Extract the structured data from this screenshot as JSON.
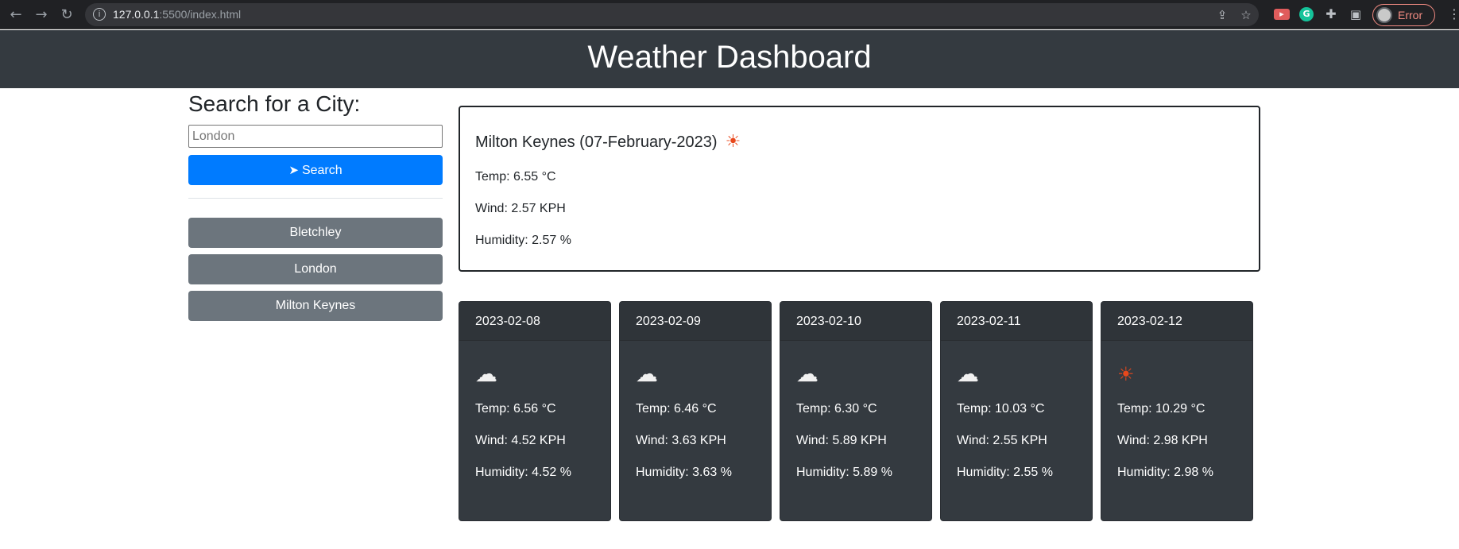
{
  "browser": {
    "url_host": "127.0.0.1",
    "url_rest": ":5500/index.html",
    "profile_status": "Error"
  },
  "header": {
    "title": "Weather Dashboard"
  },
  "sidebar": {
    "heading": "Search for a City:",
    "search_placeholder": "London",
    "search_label": "Search",
    "history": [
      {
        "label": "Bletchley"
      },
      {
        "label": "London"
      },
      {
        "label": "Milton Keynes"
      }
    ]
  },
  "current": {
    "title": "Milton Keynes (07-February-2023)",
    "icon": "sun-icon",
    "icon_glyph": "☀",
    "temp": "Temp: 6.55 °C",
    "wind": "Wind: 2.57 KPH",
    "humidity": "Humidity: 2.57 %"
  },
  "forecast": [
    {
      "date": "2023-02-08",
      "icon": "cloud-icon",
      "icon_glyph": "☁",
      "temp": "Temp: 6.56 °C",
      "wind": "Wind: 4.52 KPH",
      "humidity": "Humidity: 4.52 %"
    },
    {
      "date": "2023-02-09",
      "icon": "cloud-icon",
      "icon_glyph": "☁",
      "temp": "Temp: 6.46 °C",
      "wind": "Wind: 3.63 KPH",
      "humidity": "Humidity: 3.63 %"
    },
    {
      "date": "2023-02-10",
      "icon": "cloud-icon",
      "icon_glyph": "☁",
      "temp": "Temp: 6.30 °C",
      "wind": "Wind: 5.89 KPH",
      "humidity": "Humidity: 5.89 %"
    },
    {
      "date": "2023-02-11",
      "icon": "cloud-icon",
      "icon_glyph": "☁",
      "temp": "Temp: 10.03 °C",
      "wind": "Wind: 2.55 KPH",
      "humidity": "Humidity: 2.55 %"
    },
    {
      "date": "2023-02-12",
      "icon": "sun-icon",
      "icon_glyph": "☀",
      "temp": "Temp: 10.29 °C",
      "wind": "Wind: 2.98 KPH",
      "humidity": "Humidity: 2.98 %"
    }
  ],
  "colors": {
    "header_bg": "#343a40",
    "primary": "#007bff",
    "secondary": "#6c757d",
    "sun": "#e8481c"
  }
}
